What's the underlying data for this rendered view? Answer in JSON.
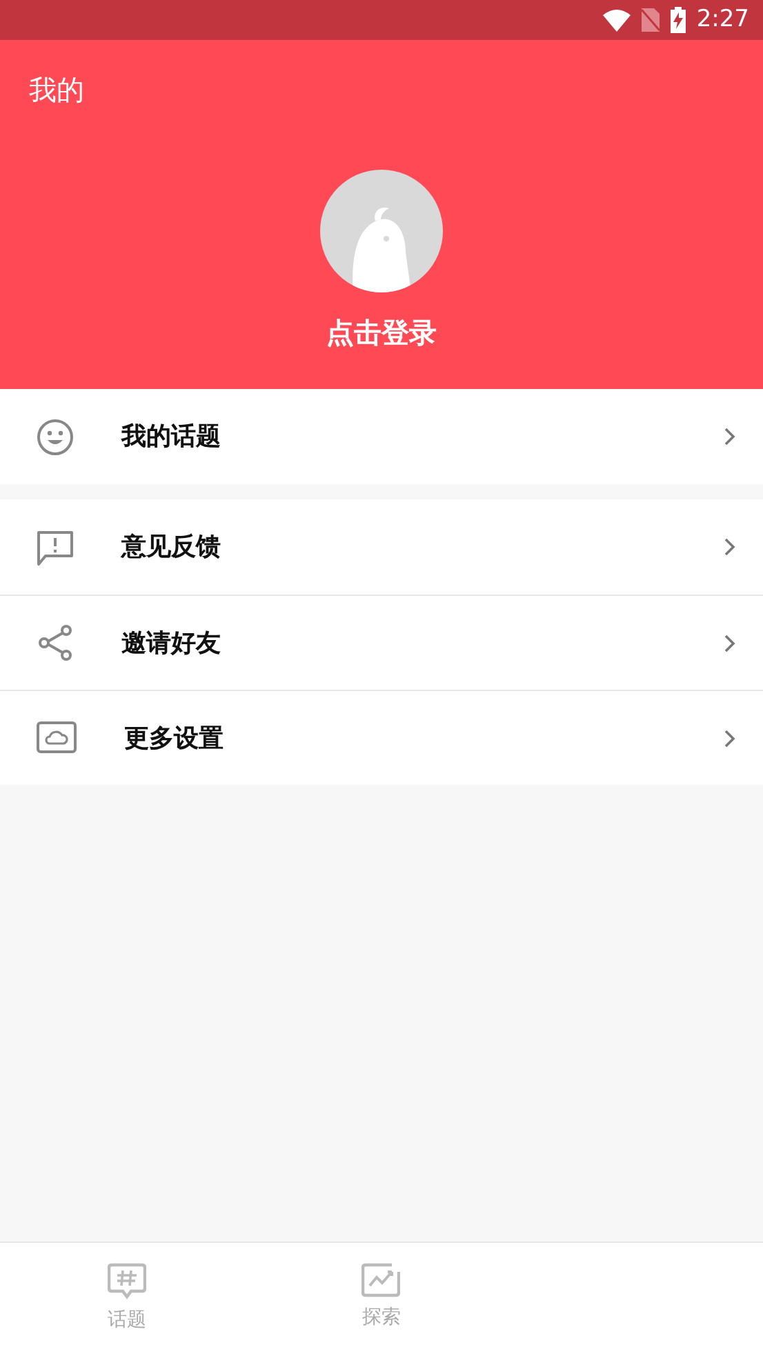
{
  "status_bar": {
    "time": "2:27"
  },
  "header": {
    "title": "我的",
    "login": "点击登录"
  },
  "menu_groups": [
    [
      {
        "kind": "topics",
        "label": "我的话题"
      }
    ],
    [
      {
        "kind": "feedback",
        "label": "意见反馈"
      },
      {
        "kind": "share",
        "label": "邀请好友"
      },
      {
        "kind": "settings",
        "label": "更多设置"
      }
    ]
  ],
  "tabs": [
    {
      "kind": "topics",
      "label": "话题",
      "selected": false
    },
    {
      "kind": "explore",
      "label": "探索",
      "selected": false
    }
  ]
}
